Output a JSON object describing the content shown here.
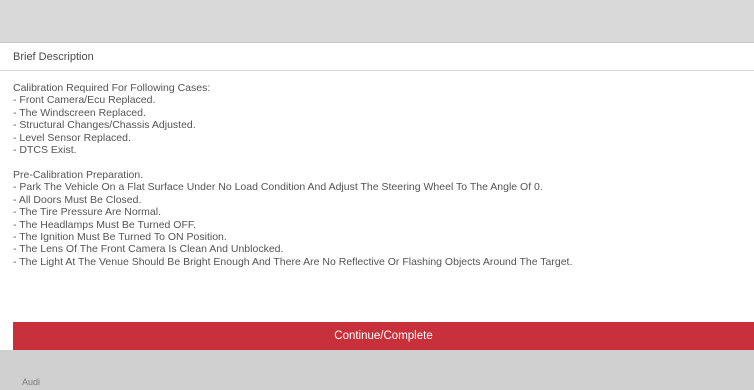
{
  "dialog": {
    "title": "Brief Description",
    "section1": {
      "heading": "Calibration Required For Following Cases:",
      "items": [
        " - Front Camera/Ecu Replaced.",
        " - The Windscreen Replaced.",
        " - Structural Changes/Chassis Adjusted.",
        " - Level Sensor Replaced.",
        " - DTCS Exist."
      ]
    },
    "section2": {
      "heading": "Pre-Calibration Preparation.",
      "items": [
        " - Park The Vehicle On a Flat Surface Under No Load Condition And Adjust The Steering Wheel To The Angle Of 0.",
        " - All Doors Must Be Closed.",
        " - The Tire Pressure Are Normal.",
        " - The Headlamps Must Be Turned OFF.",
        " - The Ignition Must Be Turned To ON Position.",
        " - The Lens Of The Front Camera Is Clean And Unblocked.",
        " - The Light At The Venue Should Be Bright Enough And There Are No Reflective Or Flashing Objects Around The Target."
      ]
    },
    "button_label": "Continue/Complete"
  },
  "bottom": {
    "partial_text": "Audi"
  }
}
